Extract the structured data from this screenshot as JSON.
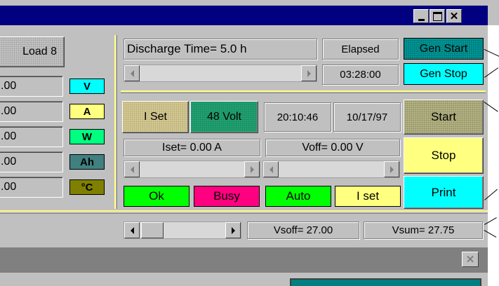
{
  "load_button": "Load 8",
  "units": [
    {
      "value": ".00",
      "unit": "V",
      "color": "#00ffff"
    },
    {
      "value": ".00",
      "unit": "A",
      "color": "#ffff80"
    },
    {
      "value": ".00",
      "unit": "W",
      "color": "#00ff80"
    },
    {
      "value": ".00",
      "unit": "Ah",
      "color": "#408080"
    },
    {
      "value": ".00",
      "unit": "°C",
      "color": "#808000"
    }
  ],
  "discharge_time": "Discharge Time= 5.0 h",
  "elapsed_label": "Elapsed",
  "elapsed_value": "03:28:00",
  "gen_start": "Gen Start",
  "gen_stop": "Gen Stop",
  "iset_button": "I Set",
  "volt_button": "48 Volt",
  "time": "20:10:46",
  "date": "10/17/97",
  "start": "Start",
  "stop": "Stop",
  "print": "Print",
  "iset_readout": "Iset= 0.00 A",
  "voff_readout": "Voff= 0.00 V",
  "status": {
    "ok": "Ok",
    "busy": "Busy",
    "auto": "Auto",
    "iset": "I set"
  },
  "vsoff": "Vsoff= 27.00",
  "vsum": "Vsum= 27.75",
  "colors": {
    "titlebar": "#000080",
    "face": "#c0c0c0",
    "accent_yellow": "#ffff80",
    "teal": "#008080",
    "cyan": "#00ffff",
    "green": "#00ff00",
    "magenta": "#ff0080",
    "olive": "#808000"
  }
}
